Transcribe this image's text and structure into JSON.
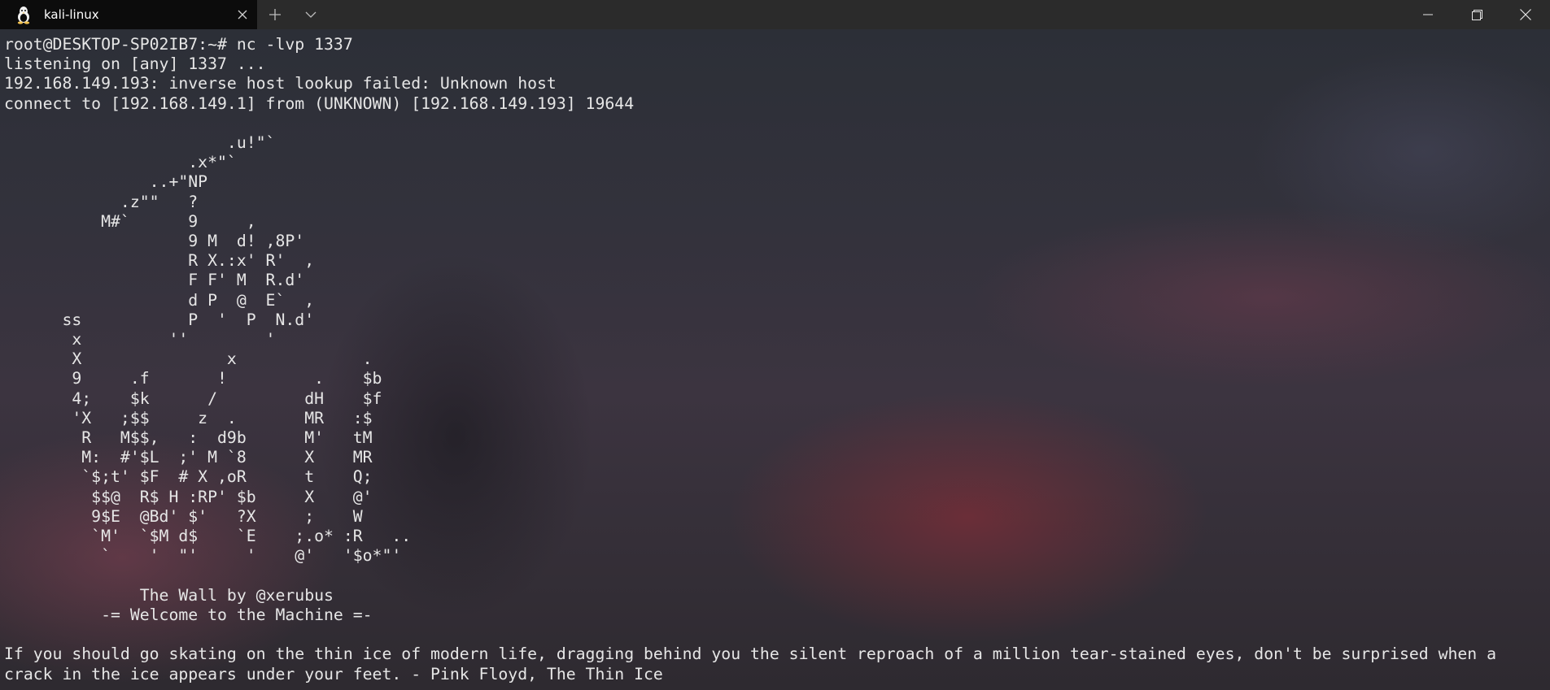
{
  "titlebar": {
    "tab_title": "kali-linux",
    "tab_icon": "tux-icon",
    "tab_close_icon": "close-icon",
    "new_tab_icon": "plus-icon",
    "dropdown_icon": "chevron-down-icon",
    "minimize_icon": "minimize-icon",
    "restore_icon": "restore-icon",
    "close_icon": "close-icon"
  },
  "terminal": {
    "lines": [
      "root@DESKTOP-SP02IB7:~# nc -lvp 1337",
      "listening on [any] 1337 ...",
      "192.168.149.193: inverse host lookup failed: Unknown host",
      "connect to [192.168.149.1] from (UNKNOWN) [192.168.149.193] 19644",
      "",
      "                       .u!\"`",
      "                   .x*\"`",
      "               ..+\"NP",
      "            .z\"\"   ?",
      "          M#`      9     ,",
      "                   9 M  d! ,8P'",
      "                   R X.:x' R'  ,",
      "                   F F' M  R.d'",
      "                   d P  @  E`  ,",
      "      ss           P  '  P  N.d'",
      "       x         ''        '",
      "       X               x             .",
      "       9     .f       !         .    $b",
      "       4;    $k      /         dH    $f",
      "       'X   ;$$     z  .       MR   :$",
      "        R   M$$,   :  d9b      M'   tM",
      "        M:  #'$L  ;' M `8      X    MR",
      "        `$;t' $F  # X ,oR      t    Q;",
      "         $$@  R$ H :RP' $b     X    @'",
      "         9$E  @Bd' $'   ?X     ;    W",
      "         `M'  `$M d$    `E    ;.o* :R   ..",
      "          `    '  \"'     '    @'   '$o*\"'",
      "",
      "              The Wall by @xerubus",
      "          -= Welcome to the Machine =-",
      "",
      "If you should go skating on the thin ice of modern life, dragging behind you the silent reproach of a million tear-stained eyes, don't be surprised when a",
      "crack in the ice appears under your feet. - Pink Floyd, The Thin Ice"
    ]
  }
}
